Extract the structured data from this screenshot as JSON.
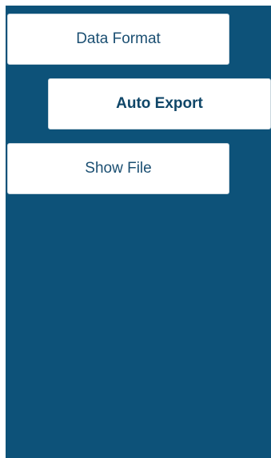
{
  "menu": {
    "items": [
      {
        "label": "Data Format",
        "active": false
      },
      {
        "label": "Auto Export",
        "active": true
      },
      {
        "label": "Show File",
        "active": false
      }
    ]
  },
  "colors": {
    "panel_background": "#0d5279",
    "button_background": "#ffffff",
    "button_text": "#1b4f72"
  }
}
